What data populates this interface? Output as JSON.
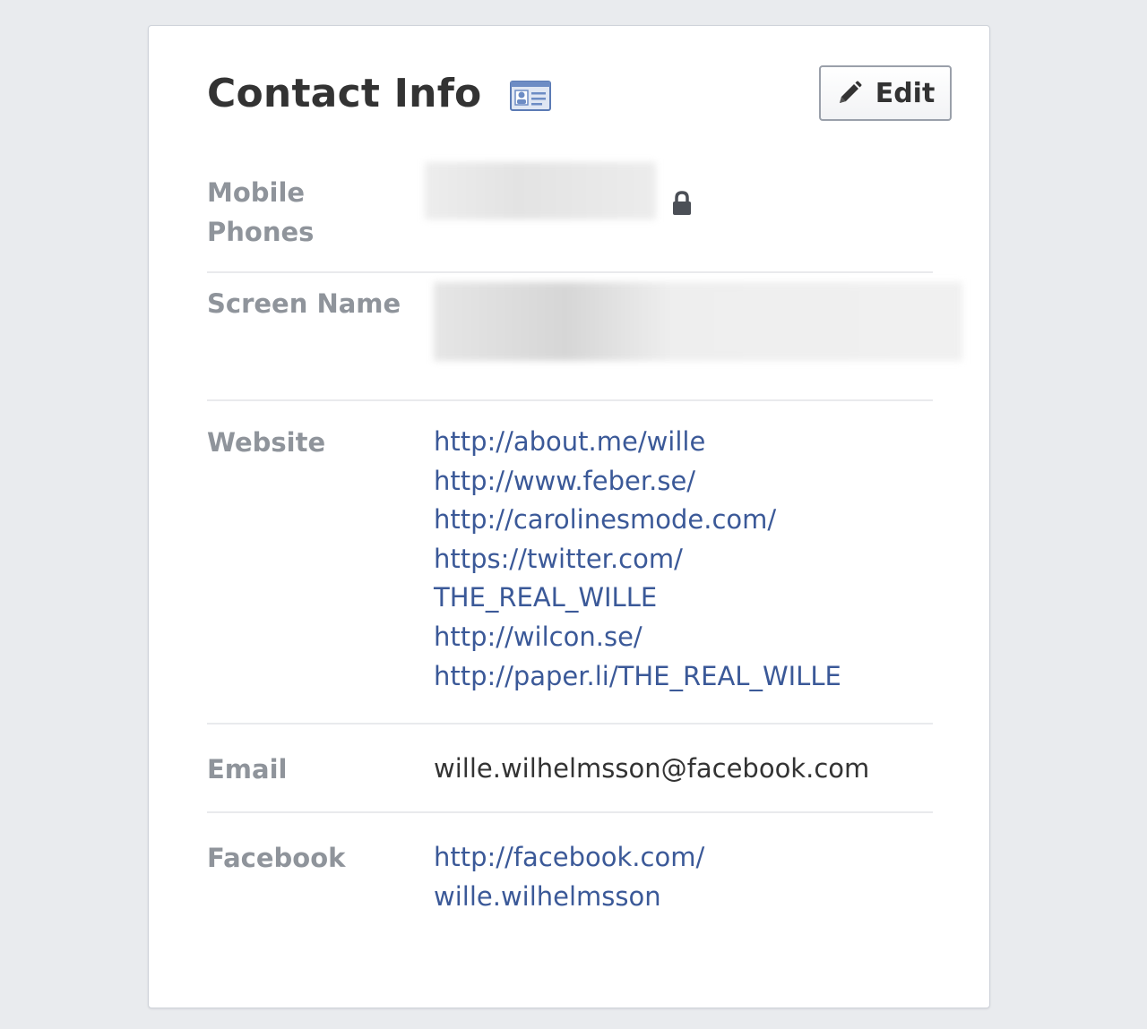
{
  "header": {
    "title": "Contact Info",
    "edit_label": "Edit"
  },
  "rows": {
    "mobile": {
      "label_line1": "Mobile",
      "label_line2": "Phones"
    },
    "screen_name": {
      "label": "Screen Name"
    },
    "website": {
      "label": "Website",
      "links": [
        "http://about.me/wille",
        "http://www.feber.se/",
        "http://carolinesmode.com/",
        "https://twitter.com/",
        "THE_REAL_WILLE",
        "http://wilcon.se/",
        "http://paper.li/THE_REAL_WILLE"
      ]
    },
    "email": {
      "label": "Email",
      "value": "wille.wilhelmsson@facebook.com"
    },
    "facebook": {
      "label": "Facebook",
      "link_line1": "http://facebook.com/",
      "link_line2": "wille.wilhelmsson"
    }
  },
  "colors": {
    "background": "#e9ebee",
    "link": "#3b5998",
    "label": "#8f949b",
    "text": "#333333",
    "divider": "#e9eaed"
  },
  "icons": {
    "title_icon": "contact-card-icon",
    "edit_icon": "pencil-icon",
    "privacy_icon": "lock-icon"
  }
}
